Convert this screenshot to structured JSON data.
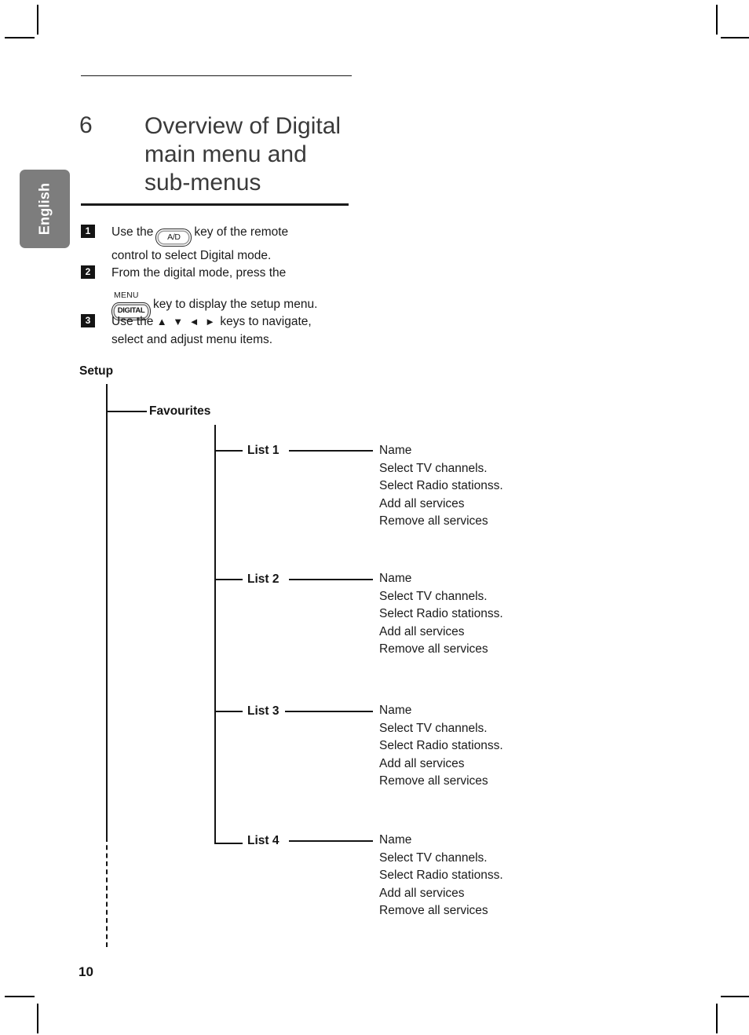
{
  "language_tab": {
    "label": "English"
  },
  "header": {
    "chapter_number": "6",
    "title_lines": [
      "Overview of Digital",
      "main menu and",
      "sub-menus"
    ]
  },
  "steps": [
    {
      "badge": "1",
      "icon": "ad-key-icon",
      "key_label": "A/D",
      "line_before": "Use the",
      "line_after": "key of the remote",
      "line2": "control to select Digital mode."
    },
    {
      "badge": "2",
      "icon": "digital-menu-key-icon",
      "key_sub_label": "MENU",
      "key_label": "DIGITAL",
      "line1": "From the digital mode, press the",
      "line_after": "key to display the setup menu."
    },
    {
      "badge": "3",
      "line_before": "Use the",
      "arrows": "▲ ▼ ◄  ►",
      "line_after": "keys to navigate,",
      "line2": "select and adjust menu items."
    }
  ],
  "tree": {
    "root_label": "Setup",
    "branch_label": "Favourites",
    "lists": [
      {
        "label": "List 1",
        "items": [
          "Name",
          "Select TV channels.",
          "Select Radio stationss.",
          "Add all services",
          "Remove all services"
        ]
      },
      {
        "label": "List 2",
        "items": [
          "Name",
          "Select TV channels.",
          "Select Radio stationss.",
          "Add all services",
          "Remove all services"
        ]
      },
      {
        "label": "List 3",
        "items": [
          "Name",
          "Select TV channels.",
          "Select Radio stationss.",
          "Add all services",
          "Remove all services"
        ]
      },
      {
        "label": "List 4",
        "items": [
          "Name",
          "Select TV channels.",
          "Select Radio stationss.",
          "Add all services",
          "Remove all services"
        ]
      }
    ]
  },
  "footer": {
    "page_number": "10"
  }
}
